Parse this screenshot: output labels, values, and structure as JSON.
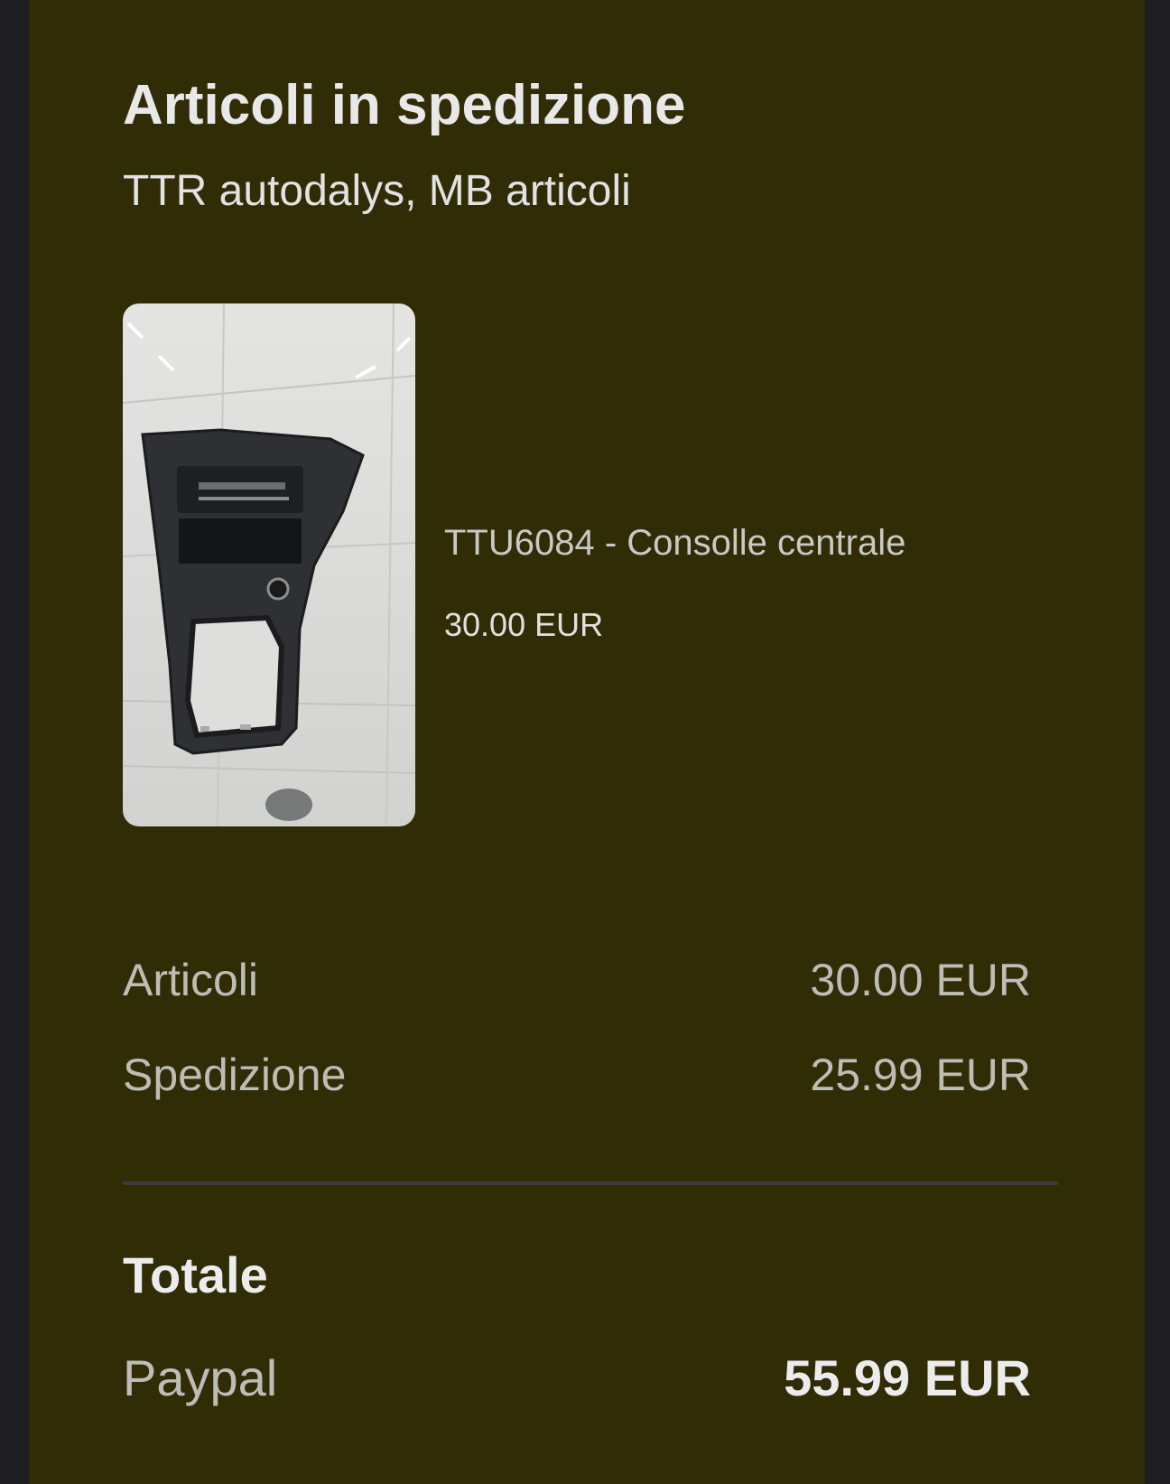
{
  "header": {
    "title": "Articoli in spedizione",
    "subtitle": "TTR autodalys, MB articoli"
  },
  "product": {
    "name": "TTU6084 - Consolle centrale",
    "price": "30.00 EUR",
    "image_icon": "car-center-console-photo"
  },
  "summary": {
    "rows": [
      {
        "label": "Articoli",
        "value": "30.00 EUR"
      },
      {
        "label": "Spedizione",
        "value": "25.99 EUR"
      }
    ]
  },
  "total": {
    "label": "Totale",
    "method": "Paypal",
    "amount": "55.99 EUR"
  },
  "colors": {
    "card_background": "#2f2c06",
    "page_background": "#1d1d22",
    "divider": "#3a3a40"
  }
}
